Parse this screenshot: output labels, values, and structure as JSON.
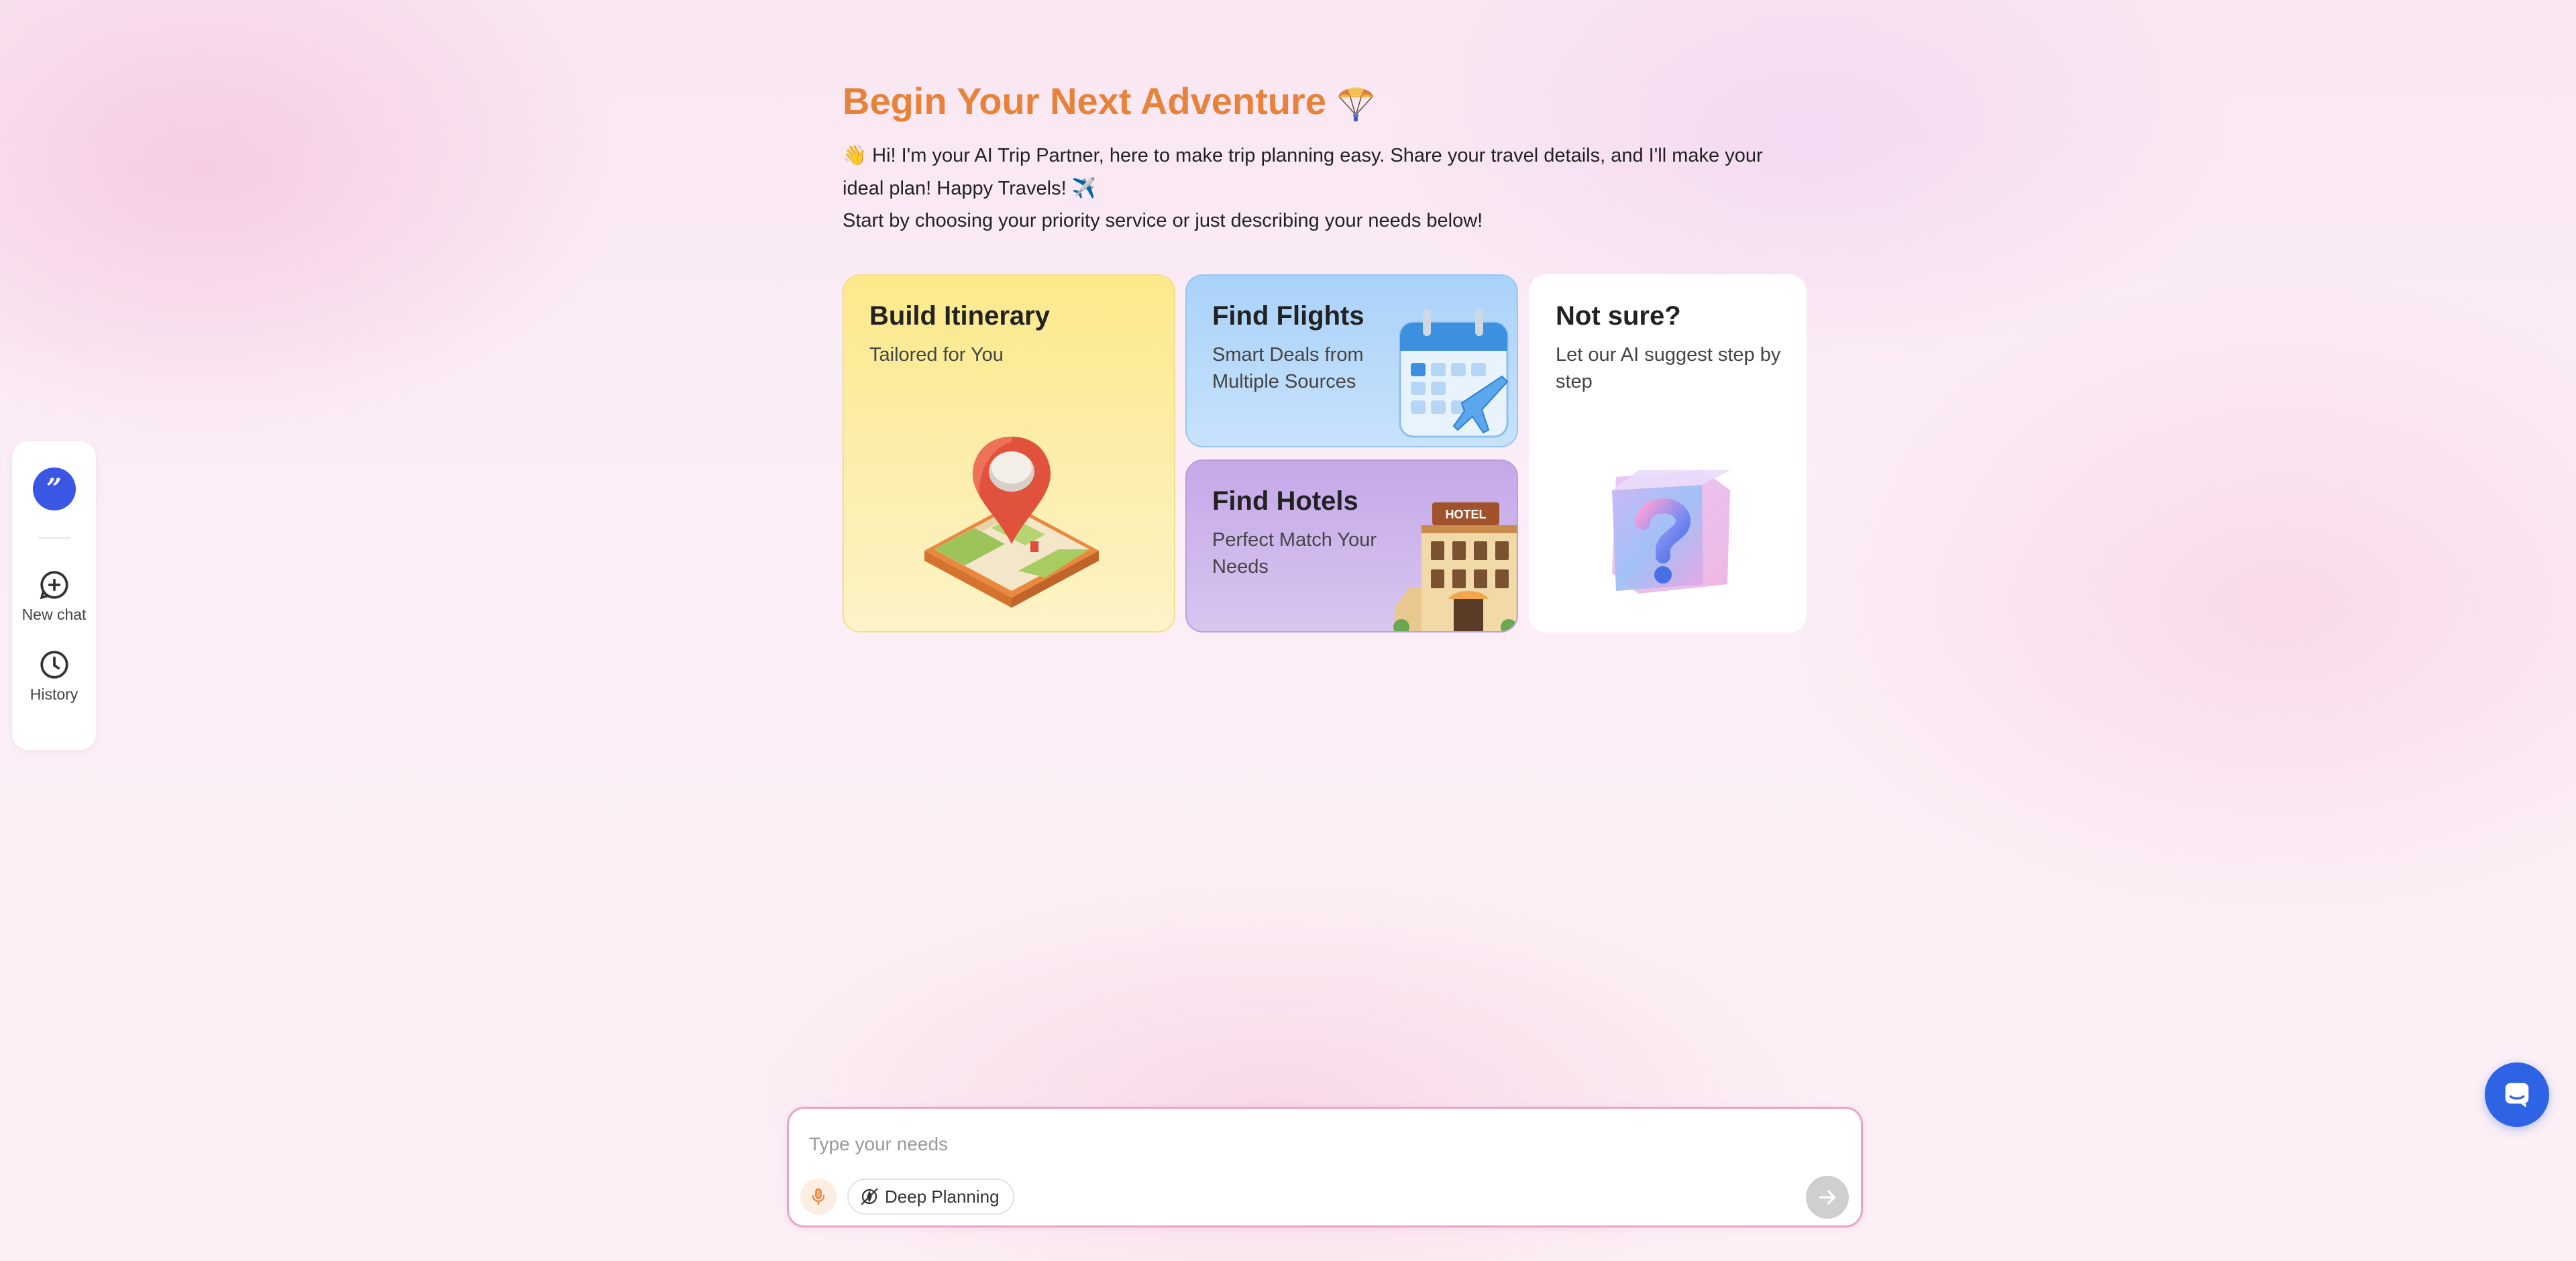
{
  "sidebar": {
    "logo_glyph": "”",
    "items": [
      {
        "label": "New chat",
        "icon": "plus-circle-icon"
      },
      {
        "label": "History",
        "icon": "clock-icon"
      }
    ]
  },
  "main": {
    "title": "Begin Your Next Adventure",
    "title_icon": "parachute-icon",
    "intro_line1": "Hi! I'm your AI Trip Partner, here to make trip planning easy. Share your travel details, and I'll make your ideal plan! Happy Travels!",
    "intro_wave_emoji": "👋",
    "intro_plane_emoji": "✈️",
    "intro_line2": "Start by choosing your priority service or just describing your needs below!"
  },
  "cards": {
    "itinerary": {
      "title": "Build Itinerary",
      "subtitle": "Tailored for You",
      "icon": "map-pin-icon"
    },
    "flights": {
      "title": "Find Flights",
      "subtitle": "Smart Deals from Multiple Sources",
      "icon": "calendar-plane-icon"
    },
    "hotels": {
      "title": "Find Hotels",
      "subtitle": "Perfect Match Your Needs",
      "icon": "hotel-icon",
      "hotel_sign": "HOTEL"
    },
    "not_sure": {
      "title": "Not sure?",
      "subtitle": "Let our AI suggest step by step",
      "icon": "question-cube-icon"
    }
  },
  "chat": {
    "placeholder": "Type your needs",
    "deep_planning_label": "Deep Planning"
  },
  "colors": {
    "accent_orange": "#e8823a",
    "brand_blue": "#3a56e4",
    "support_blue": "#2f63e6",
    "itinerary_yellow": "#fbe98a",
    "flights_blue": "#a9d2fa",
    "hotels_purple": "#c4a8e8"
  }
}
